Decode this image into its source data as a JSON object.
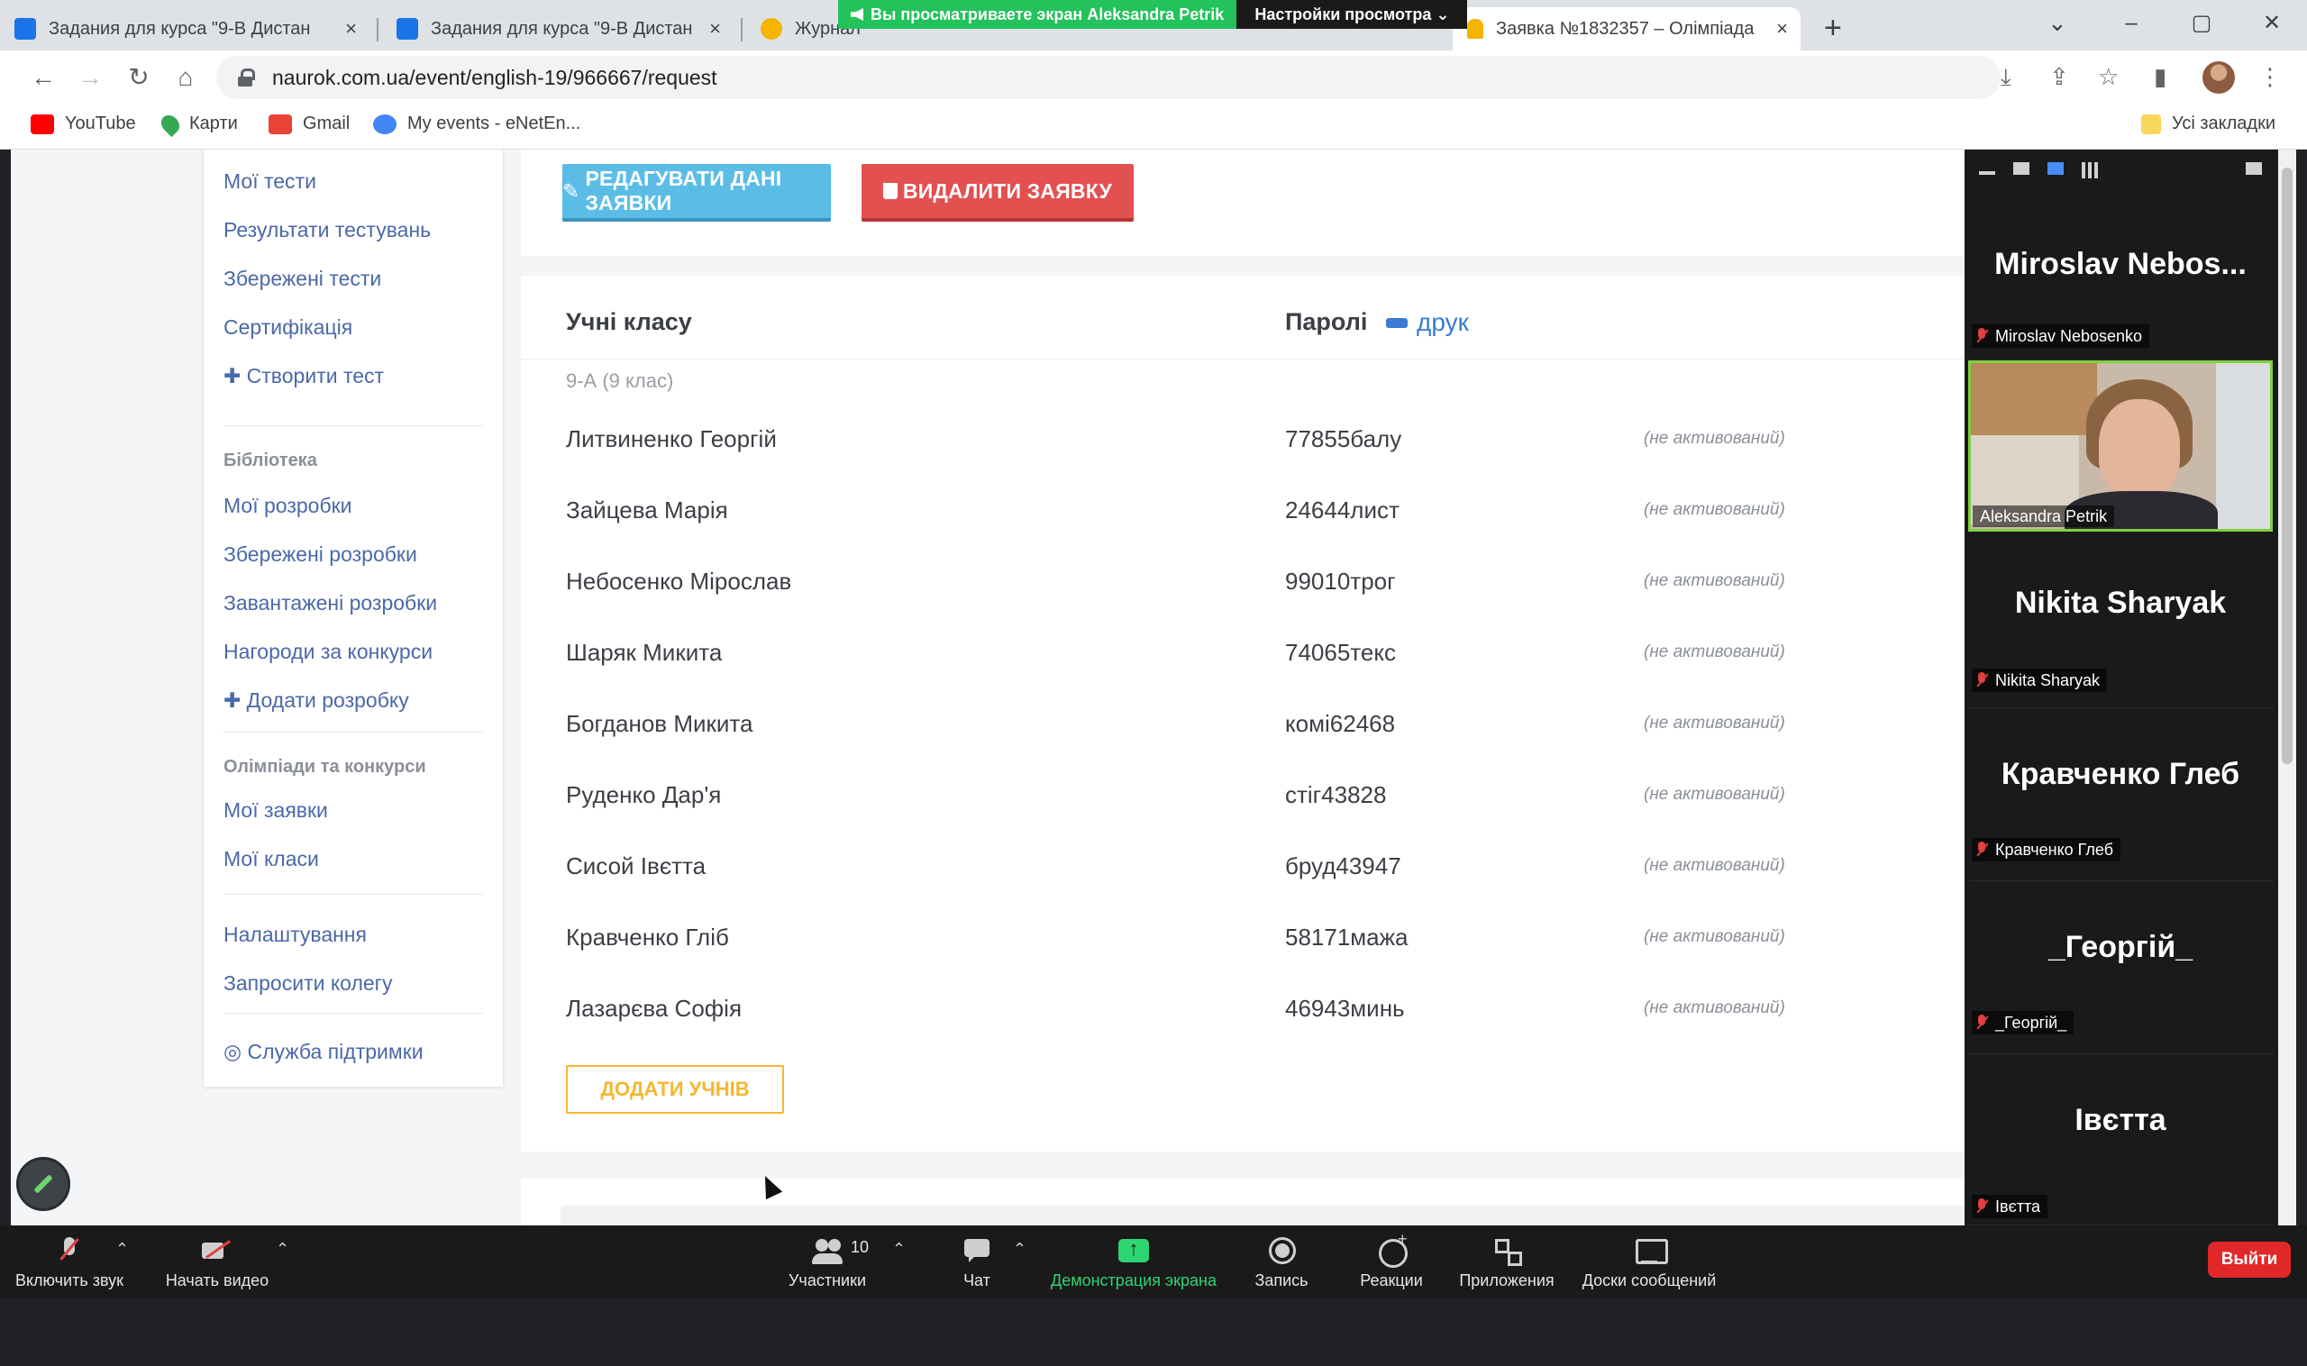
{
  "browser": {
    "tabs": [
      {
        "title": "Задания для курса \"9-В Дистан",
        "favicon_color": "#1a73e8"
      },
      {
        "title": "Задания для курса \"9-В Дистан",
        "favicon_color": "#1a73e8"
      },
      {
        "title": "Журнал",
        "favicon_color": "#f4b400"
      },
      {
        "title": "Заявка №1832357 – Олімпіада",
        "favicon_color": "#f4b400"
      }
    ],
    "url": "naurok.com.ua/event/english-19/966667/request",
    "bookmarks": [
      {
        "label": "YouTube",
        "color": "#ff0000"
      },
      {
        "label": "Карти",
        "color": "#34a853"
      },
      {
        "label": "Gmail",
        "color": "#ea4335"
      },
      {
        "label": "My events - eNetEn...",
        "color": "#4285f4"
      }
    ],
    "all_bookmarks": "Усі закладки"
  },
  "share_banner": {
    "message": "Вы просматриваете экран Aleksandra Petrik",
    "settings": "Настройки просмотра"
  },
  "sidebar": {
    "items": [
      {
        "type": "link",
        "label": "Мої тести"
      },
      {
        "type": "link",
        "label": "Результати тестувань"
      },
      {
        "type": "link",
        "label": "Збережені тести"
      },
      {
        "type": "link",
        "label": "Сертифікація"
      },
      {
        "type": "link",
        "label": "✚ Створити тест"
      },
      {
        "type": "head",
        "label": "Бібліотека"
      },
      {
        "type": "link",
        "label": "Мої розробки"
      },
      {
        "type": "link",
        "label": "Збережені розробки"
      },
      {
        "type": "link",
        "label": "Завантажені розробки"
      },
      {
        "type": "link",
        "label": "Нагороди за конкурси"
      },
      {
        "type": "link",
        "label": "✚ Додати розробку"
      },
      {
        "type": "head",
        "label": "Олімпіади та конкурси"
      },
      {
        "type": "link",
        "label": "Мої заявки"
      },
      {
        "type": "link",
        "label": "Мої класи"
      },
      {
        "type": "link",
        "label": "Налаштування"
      },
      {
        "type": "link",
        "label": "Запросити колегу"
      },
      {
        "type": "link",
        "label": "Служба підтримки"
      }
    ]
  },
  "actions": {
    "edit": "РЕДАГУВАТИ ДАНІ ЗАЯВКИ",
    "delete": "ВИДАЛИТИ ЗАЯВКУ"
  },
  "table": {
    "col_students": "Учні класу",
    "col_passwords": "Паролі",
    "print": "друк",
    "class_label": "9-А (9 клас)",
    "rows": [
      {
        "name": "Литвиненко Георгій",
        "password": "77855балу",
        "status": "(не активований)"
      },
      {
        "name": "Зайцева Марія",
        "password": "24644лист",
        "status": "(не активований)"
      },
      {
        "name": "Небосенко Мірослав",
        "password": "99010трог",
        "status": "(не активований)"
      },
      {
        "name": "Шаряк Микита",
        "password": "74065текс",
        "status": "(не активований)"
      },
      {
        "name": "Богданов Микита",
        "password": "комі62468",
        "status": "(не активований)"
      },
      {
        "name": "Руденко Дар'я",
        "password": "стіг43828",
        "status": "(не активований)"
      },
      {
        "name": "Сисой Івєтта",
        "password": "бруд43947",
        "status": "(не активований)"
      },
      {
        "name": "Кравченко Гліб",
        "password": "58171мажа",
        "status": "(не активований)"
      },
      {
        "name": "Лазарєва Софія",
        "password": "46943минь",
        "status": "(не активований)"
      }
    ],
    "add_students": "ДОДАТИ УЧНІВ"
  },
  "gallery": {
    "tiles": [
      {
        "big": "Miroslav  Nebos...",
        "label": "Miroslav Nebosenko",
        "muted": true
      },
      {
        "video": true,
        "label": "Aleksandra Petrik",
        "muted": false
      },
      {
        "big": "Nikita Sharyak",
        "label": "Nikita Sharyak",
        "muted": true
      },
      {
        "big": "Кравченко Глеб",
        "label": "Кравченко Глеб",
        "muted": true
      },
      {
        "big": "_Георгій_",
        "label": "_Георгій_",
        "muted": true
      },
      {
        "big": "Івєтта",
        "label": "Івєтта",
        "muted": true
      }
    ]
  },
  "zoom_toolbar": {
    "unmute": "Включить звук",
    "start_video": "Начать видео",
    "participants": "Участники",
    "participants_count": "10",
    "chat": "Чат",
    "share": "Демонстрация экрана",
    "record": "Запись",
    "reactions": "Реакции",
    "apps": "Приложения",
    "boards": "Доски сообщений",
    "leave": "Выйти"
  }
}
